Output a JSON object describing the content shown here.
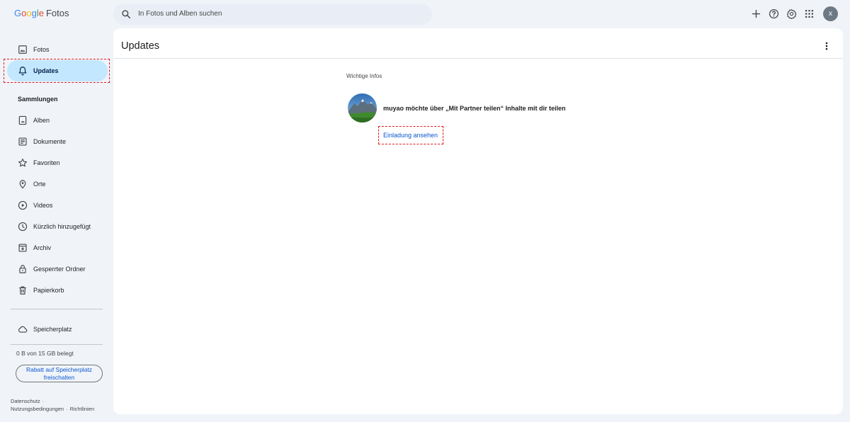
{
  "header": {
    "logo": {
      "g1": "G",
      "g2": "o",
      "g3": "o",
      "g4": "g",
      "g5": "l",
      "g6": "e",
      "product": "Fotos"
    },
    "search_placeholder": "In Fotos und Alben suchen",
    "icons": [
      "add-icon",
      "help-icon",
      "settings-icon",
      "apps-icon"
    ],
    "avatar_letter": "x"
  },
  "sidebar": {
    "nav": [
      {
        "label": "Fotos",
        "icon": "photo-icon"
      },
      {
        "label": "Updates",
        "icon": "bell-icon",
        "active": true
      }
    ],
    "collections_title": "Sammlungen",
    "collections": [
      {
        "label": "Alben",
        "icon": "album-icon"
      },
      {
        "label": "Dokumente",
        "icon": "document-icon"
      },
      {
        "label": "Favoriten",
        "icon": "star-icon"
      },
      {
        "label": "Orte",
        "icon": "location-icon"
      },
      {
        "label": "Videos",
        "icon": "play-circle-icon"
      },
      {
        "label": "Kürzlich hinzugefügt",
        "icon": "clock-icon"
      },
      {
        "label": "Archiv",
        "icon": "archive-icon"
      },
      {
        "label": "Gesperrter Ordner",
        "icon": "lock-icon"
      },
      {
        "label": "Papierkorb",
        "icon": "trash-icon"
      }
    ],
    "storage_label": "Speicherplatz",
    "storage_used": "0 B von 15 GB belegt",
    "upgrade_label": "Rabatt auf Speicherplatz freischalten",
    "footer": {
      "privacy": "Datenschutz",
      "terms": "Nutzungsbedingungen",
      "policies": "Richtlinien"
    }
  },
  "main": {
    "title": "Updates",
    "section_heading": "Wichtige Infos",
    "notification": {
      "text": "muyao möchte über „Mit Partner teilen“ Inhalte mit dir teilen",
      "action": "Einladung ansehen"
    }
  },
  "colors": {
    "accent": "#0b57d0",
    "active_nav": "#c2e7ff",
    "highlight": "#e0191e",
    "background": "#f0f4f9"
  }
}
